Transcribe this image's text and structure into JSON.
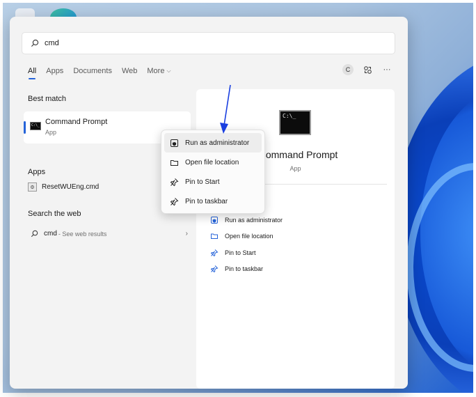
{
  "search": {
    "query": "cmd"
  },
  "tabs": [
    {
      "label": "All"
    },
    {
      "label": "Apps"
    },
    {
      "label": "Documents"
    },
    {
      "label": "Web"
    },
    {
      "label": "More"
    }
  ],
  "account": {
    "initial": "C"
  },
  "left": {
    "best_match_title": "Best match",
    "best_match": {
      "name": "Command Prompt",
      "type": "App",
      "icon_glyph": "C:\\_"
    },
    "apps_title": "Apps",
    "apps": [
      {
        "name": "ResetWUEng.cmd",
        "icon_glyph": "⚙"
      }
    ],
    "web_title": "Search the web",
    "web": {
      "query": "cmd",
      "suffix": "- See web results"
    }
  },
  "detail": {
    "icon_glyph": "C:\\_",
    "title": "Command Prompt",
    "subtitle": "App",
    "actions": [
      {
        "label": "Run as administrator",
        "icon": "shield-icon"
      },
      {
        "label": "Open file location",
        "icon": "folder-icon"
      },
      {
        "label": "Pin to Start",
        "icon": "pin-icon"
      },
      {
        "label": "Pin to taskbar",
        "icon": "pin-icon"
      }
    ]
  },
  "context_menu": {
    "items": [
      {
        "label": "Run as administrator",
        "icon": "shield-icon"
      },
      {
        "label": "Open file location",
        "icon": "folder-icon"
      },
      {
        "label": "Pin to Start",
        "icon": "pin-icon"
      },
      {
        "label": "Pin to taskbar",
        "icon": "pin-icon"
      }
    ]
  },
  "colors": {
    "accent": "#2563d9",
    "arrow": "#1a3fe0"
  }
}
